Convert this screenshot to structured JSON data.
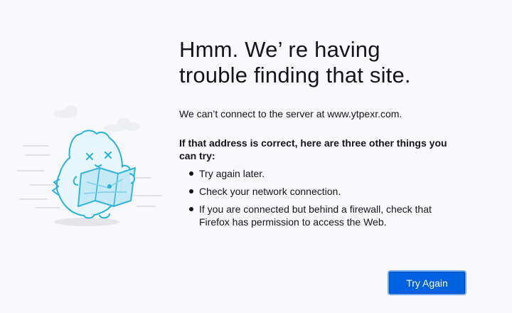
{
  "error_page": {
    "title_line1": "Hmm. We’ re having",
    "title_line2": "trouble finding that site.",
    "short_description": "We can’t connect to the server at www.ytpexr.com.",
    "try_heading": "If that address is correct, here are three other things you can try:",
    "suggestions": [
      "Try again later.",
      "Check your network connection.",
      "If you are connected but behind a firewall, check that Firefox has permission to access the Web."
    ],
    "try_again_label": "Try Again"
  },
  "illustration": {
    "icon": "confused-dinosaur-with-map-illustration",
    "colors": {
      "outline": "#2ab3d9",
      "fill": "#e6f6fc",
      "map": "#c5e9f7",
      "cloud": "#eeeff2",
      "speed_lines": "#d4d4da"
    }
  },
  "colors": {
    "background": "#f9f9fb",
    "text": "#15141a",
    "button": "#0061e0",
    "button_text": "#ffffff"
  }
}
